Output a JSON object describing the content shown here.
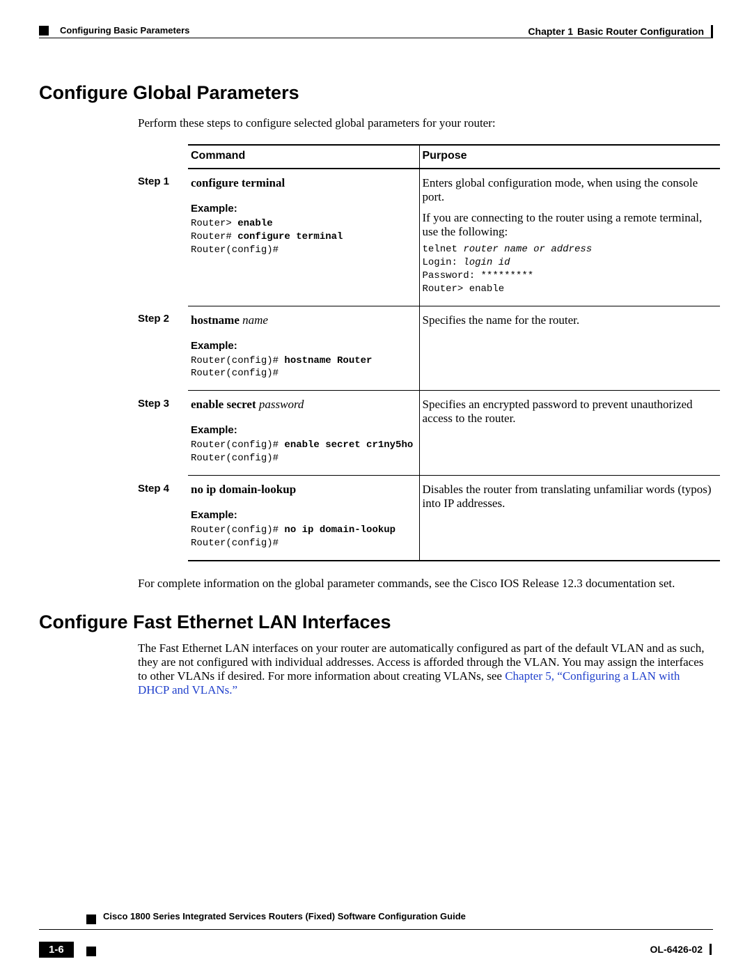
{
  "header": {
    "chapter_label": "Chapter 1",
    "chapter_title": "Basic Router Configuration",
    "section": "Configuring Basic Parameters"
  },
  "section1": {
    "title": "Configure Global Parameters",
    "lead": "Perform these steps to configure selected global parameters for your router:",
    "table": {
      "headers": {
        "command": "Command",
        "purpose": "Purpose"
      },
      "steps": [
        {
          "step": "Step 1",
          "command": "configure terminal",
          "arg": "",
          "example_label": "Example:",
          "example": {
            "l1_pre": "Router> ",
            "l1_b": "enable",
            "l2_pre": "Router# ",
            "l2_b": "configure terminal",
            "l3": "Router(config)#"
          },
          "purpose": {
            "p1": "Enters global configuration mode, when using the console port.",
            "p2": "If you are connecting to the router using a remote terminal, use the following:",
            "code": {
              "l1a": "telnet ",
              "l1b": "router name or address",
              "l2a": "Login: ",
              "l2b": "login id",
              "l3": "Password: *********",
              "l4": "Router> enable"
            }
          }
        },
        {
          "step": "Step 2",
          "command": "hostname",
          "arg": "name",
          "example_label": "Example:",
          "example": {
            "l1_pre": "Router(config)# ",
            "l1_b": "hostname Router",
            "l2": "Router(config)#"
          },
          "purpose": {
            "p1": "Specifies the name for the router."
          }
        },
        {
          "step": "Step 3",
          "command": "enable secret",
          "arg": "password",
          "example_label": "Example:",
          "example": {
            "l1_pre": "Router(config)# ",
            "l1_b": "enable secret cr1ny5ho",
            "l2": "Router(config)#"
          },
          "purpose": {
            "p1": "Specifies an encrypted password to prevent unauthorized access to the router."
          }
        },
        {
          "step": "Step 4",
          "command": "no ip domain-lookup",
          "arg": "",
          "example_label": "Example:",
          "example": {
            "l1_pre": "Router(config)# ",
            "l1_b": "no ip domain-lookup",
            "l2": "Router(config)#"
          },
          "purpose": {
            "p1": "Disables the router from translating unfamiliar words (typos) into IP addresses."
          }
        }
      ]
    },
    "after": "For complete information on the global parameter commands, see the Cisco IOS Release 12.3 documentation set."
  },
  "section2": {
    "title": "Configure Fast Ethernet LAN Interfaces",
    "body_pre": "The Fast Ethernet LAN interfaces on your router are automatically configured as part of the default VLAN and as such, they are not configured with individual addresses. Access is afforded through the VLAN. You may assign the interfaces to other VLANs if desired. For more information about creating VLANs, see ",
    "link": "Chapter 5, “Configuring a LAN with DHCP and VLANs.”"
  },
  "footer": {
    "guide": "Cisco 1800 Series Integrated Services Routers (Fixed) Software Configuration Guide",
    "page": "1-6",
    "doc": "OL-6426-02"
  }
}
